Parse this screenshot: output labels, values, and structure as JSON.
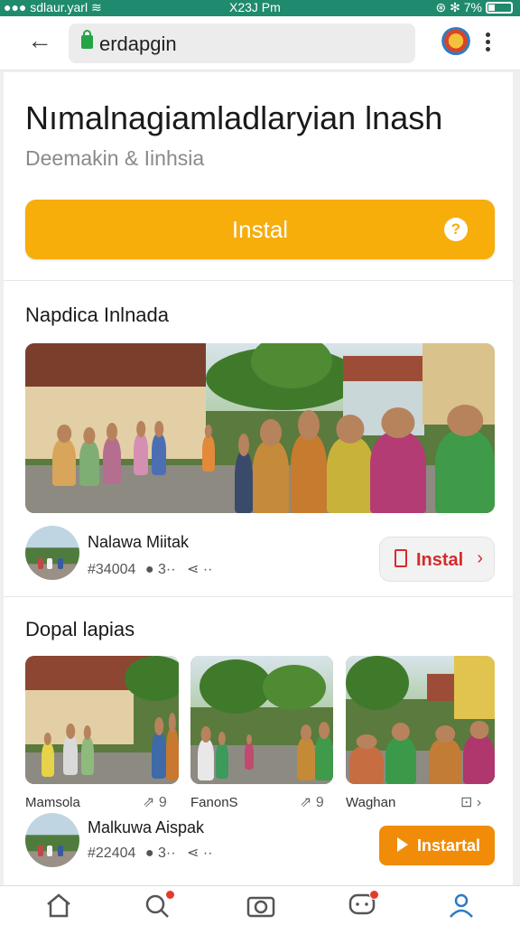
{
  "status": {
    "carrier": "sdlaur.yarl",
    "time": "X23J Pm",
    "battery": "7%"
  },
  "browser": {
    "url": "erdapgin"
  },
  "app": {
    "title": "Nımalnagiamladlaryian lnash",
    "subtitle": "Deemakin &  Iinhsia",
    "install_label": "Instal"
  },
  "section1": {
    "title": "Napdica Inlnada",
    "item": {
      "name": "Nalawa Miitak",
      "id": "#34004",
      "count": "3",
      "install_label": "Instal"
    }
  },
  "section2": {
    "title": "Dopal lapias",
    "thumbs": [
      {
        "label": "Mamsola",
        "count": "9"
      },
      {
        "label": "FanonS",
        "count": "9"
      },
      {
        "label": "Waghan"
      }
    ],
    "item": {
      "name": "Malkuwa Aispak",
      "id": "#22404",
      "count": "3",
      "install_label": "Instartal"
    }
  },
  "nav": {
    "items": [
      {
        "icon": "home-icon"
      },
      {
        "icon": "search-icon",
        "badge": true
      },
      {
        "icon": "camera-icon"
      },
      {
        "icon": "chat-icon",
        "badge": true
      },
      {
        "icon": "profile-icon",
        "active": true
      }
    ]
  },
  "colors": {
    "status_bar": "#1f8a6e",
    "install_yellow": "#f7ad0a",
    "install_orange": "#f08c08",
    "install_red": "#d52b2b",
    "nav_active": "#2b7bc4"
  }
}
